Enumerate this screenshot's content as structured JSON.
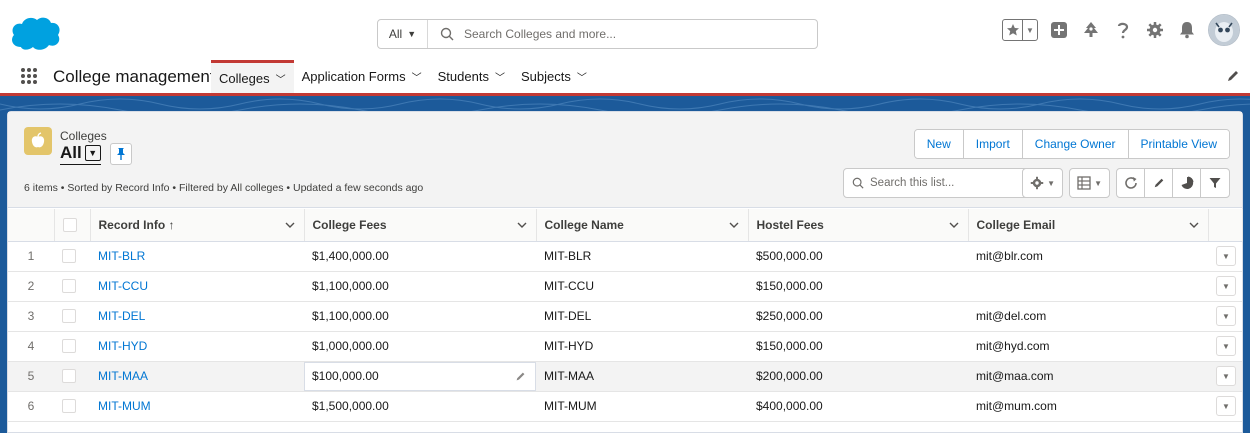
{
  "global_header": {
    "scope_label": "All",
    "search_placeholder": "Search Colleges and more..."
  },
  "app_nav": {
    "app_name": "College management",
    "tabs": [
      {
        "label": "Colleges"
      },
      {
        "label": "Application Forms"
      },
      {
        "label": "Students"
      },
      {
        "label": "Subjects"
      }
    ]
  },
  "list_view": {
    "object_label": "Colleges",
    "view_name": "All",
    "meta": "6 items • Sorted by Record Info • Filtered by All colleges • Updated a few seconds ago",
    "actions": {
      "new": "New",
      "import": "Import",
      "change_owner": "Change Owner",
      "printable_view": "Printable View"
    },
    "search_placeholder": "Search this list...",
    "columns": {
      "record_info": "Record Info ↑",
      "college_fees": "College Fees",
      "college_name": "College Name",
      "hostel_fees": "Hostel Fees",
      "college_email": "College Email"
    },
    "rows": [
      {
        "num": "1",
        "record": "MIT-BLR",
        "fees": "$1,400,000.00",
        "name": "MIT-BLR",
        "hostel": "$500,000.00",
        "email": "mit@blr.com"
      },
      {
        "num": "2",
        "record": "MIT-CCU",
        "fees": "$1,100,000.00",
        "name": "MIT-CCU",
        "hostel": "$150,000.00",
        "email": ""
      },
      {
        "num": "3",
        "record": "MIT-DEL",
        "fees": "$1,100,000.00",
        "name": "MIT-DEL",
        "hostel": "$250,000.00",
        "email": "mit@del.com"
      },
      {
        "num": "4",
        "record": "MIT-HYD",
        "fees": "$1,000,000.00",
        "name": "MIT-HYD",
        "hostel": "$150,000.00",
        "email": "mit@hyd.com"
      },
      {
        "num": "5",
        "record": "MIT-MAA",
        "fees": "$100,000.00",
        "name": "MIT-MAA",
        "hostel": "$200,000.00",
        "email": "mit@maa.com"
      },
      {
        "num": "6",
        "record": "MIT-MUM",
        "fees": "$1,500,000.00",
        "name": "MIT-MUM",
        "hostel": "$400,000.00",
        "email": "mit@mum.com"
      }
    ]
  },
  "colors": {
    "brand_blue": "#00a1e0",
    "link": "#0176d3",
    "nav_accent": "#c23934",
    "background_band": "#1c5a9a",
    "object_icon": "#e3c56a"
  }
}
